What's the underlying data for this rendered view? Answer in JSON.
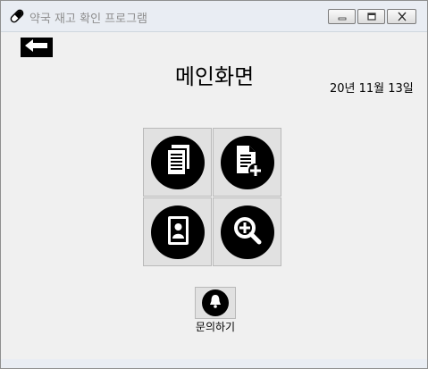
{
  "window": {
    "title": "약국 재고 확인 프로그램"
  },
  "header": {
    "page_title": "메인화면",
    "date": "20년 11월 13일"
  },
  "menu": {
    "buttons": [
      {
        "icon": "document-list-icon"
      },
      {
        "icon": "add-document-icon"
      },
      {
        "icon": "contact-book-icon"
      },
      {
        "icon": "zoom-in-icon"
      }
    ]
  },
  "inquiry": {
    "label": "문의하기",
    "icon": "bell-icon"
  }
}
